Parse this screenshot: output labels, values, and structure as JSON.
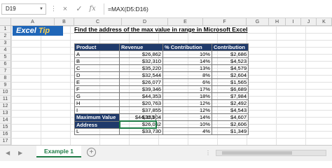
{
  "formula_bar": {
    "cell_reference": "D19",
    "cancel_icon": "×",
    "enter_icon": "✓",
    "fx_label": "fx",
    "formula": "=MAX(D5:D16)"
  },
  "columns": [
    "A",
    "B",
    "C",
    "D",
    "E",
    "F",
    "G",
    "H",
    "I",
    "J",
    "K"
  ],
  "rows": [
    "1",
    "2",
    "3",
    "4",
    "5",
    "6",
    "7",
    "8",
    "9",
    "10",
    "11",
    "12",
    "13",
    "14",
    "15",
    "16",
    "17",
    "18",
    "19",
    "20"
  ],
  "logo": {
    "main": "Excel",
    "accent": "Tip"
  },
  "sheet_title": "Find the address of the max value in range in Microsoft Excel",
  "table": {
    "headers": [
      "Product",
      "Revenue",
      "% Contribution",
      "Contribution"
    ],
    "rows": [
      [
        "A",
        "$26,862",
        "10%",
        "$2,686"
      ],
      [
        "B",
        "$32,310",
        "14%",
        "$4,523"
      ],
      [
        "C",
        "$35,220",
        "13%",
        "$4,579"
      ],
      [
        "D",
        "$32,544",
        "8%",
        "$2,604"
      ],
      [
        "E",
        "$26,077",
        "6%",
        "$1,565"
      ],
      [
        "F",
        "$39,346",
        "17%",
        "$6,689"
      ],
      [
        "G",
        "$44,353",
        "18%",
        "$7,984"
      ],
      [
        "H",
        "$20,763",
        "12%",
        "$2,492"
      ],
      [
        "I",
        "$37,855",
        "12%",
        "$4,543"
      ],
      [
        "J",
        "$32,904",
        "14%",
        "$4,607"
      ],
      [
        "K",
        "$26,062",
        "10%",
        "$2,606"
      ],
      [
        "L",
        "$33,730",
        "4%",
        "$1,349"
      ]
    ]
  },
  "summary": {
    "max_label": "Maximum Value",
    "max_value": "$44,353",
    "address_label": "Address",
    "address_value": ""
  },
  "sheet_tabs": {
    "prev_icon": "◀",
    "next_icon": "▶",
    "active_tab": "Example 1",
    "add_icon": "+",
    "separator_icon": "⋮"
  },
  "colors": {
    "header_fill": "#1f3a6b",
    "accent_green": "#1e7b46",
    "logo_blue": "#1f66b8"
  }
}
